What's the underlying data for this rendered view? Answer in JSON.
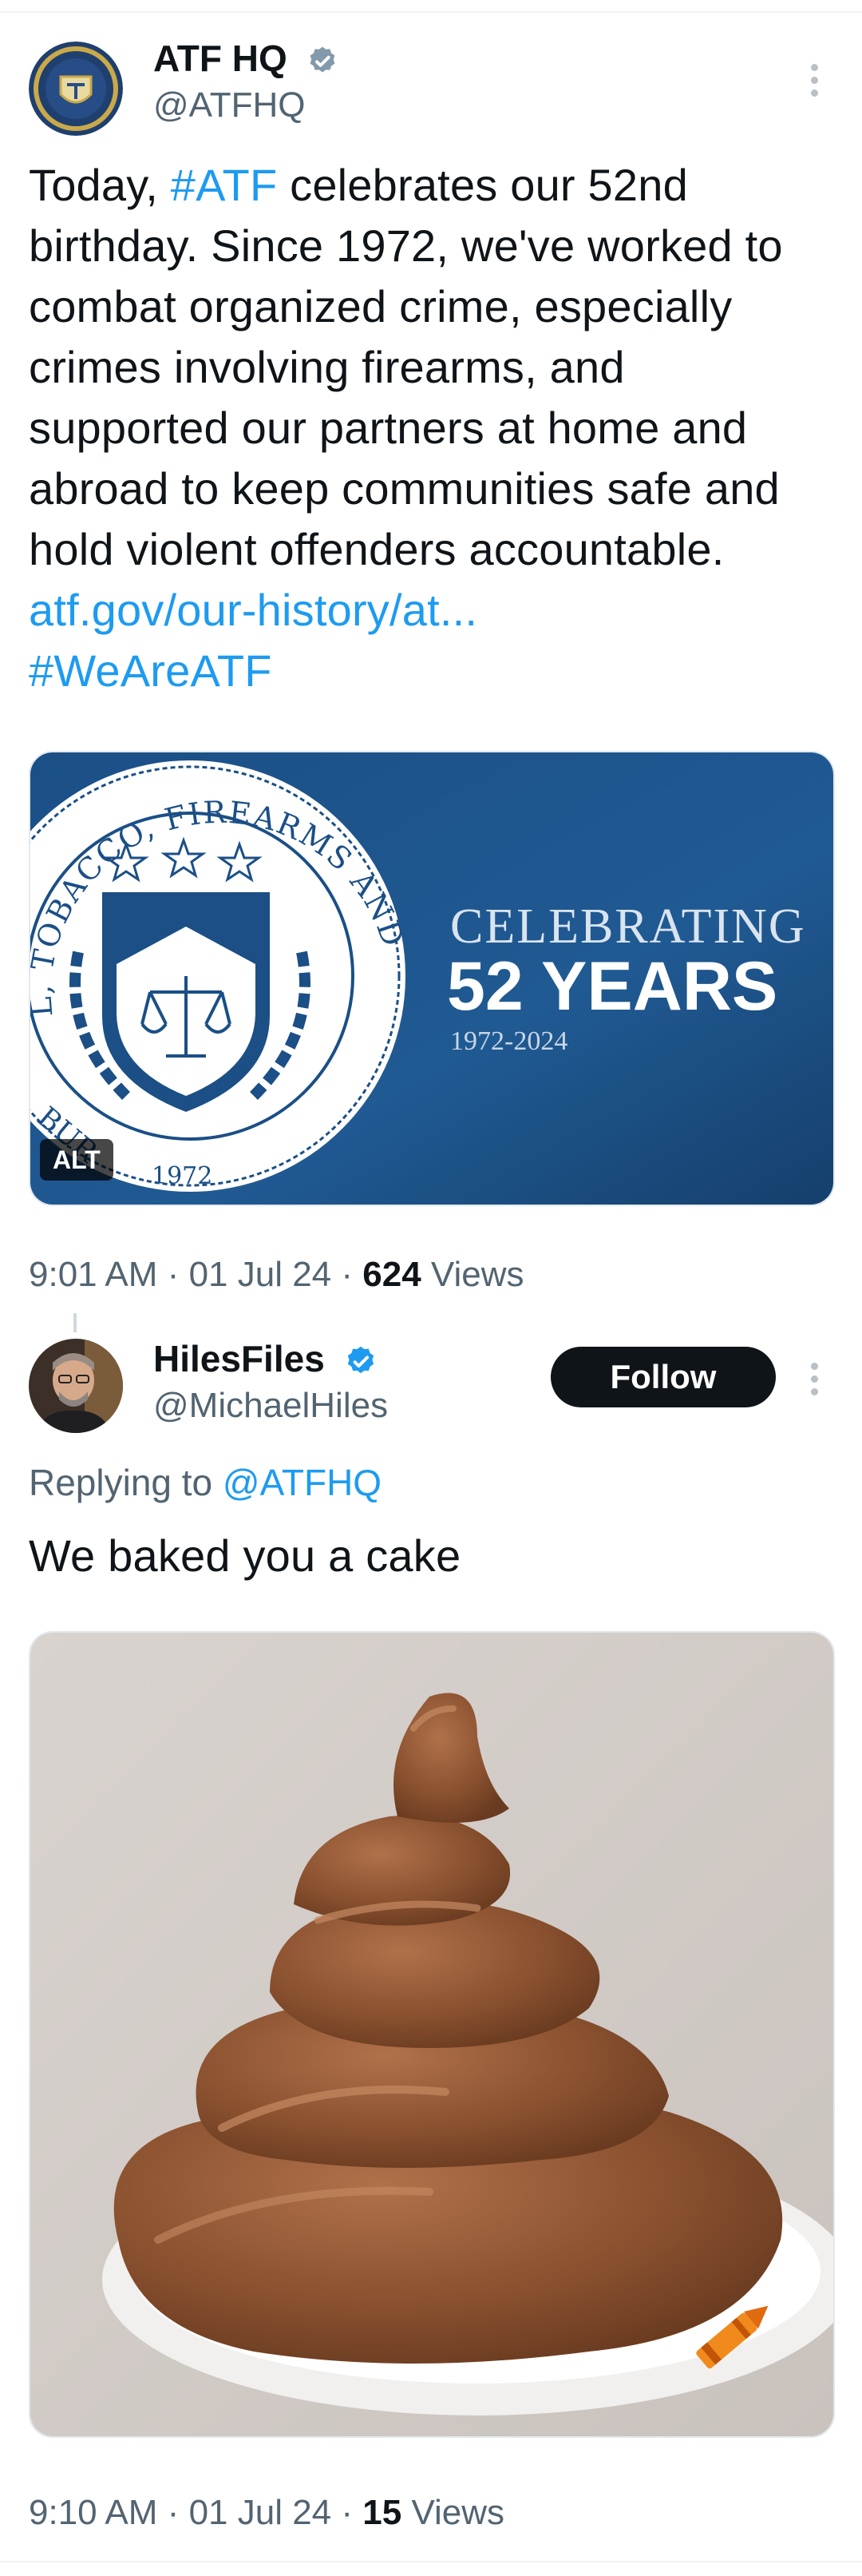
{
  "tweet1": {
    "name": "ATF HQ",
    "handle": "@ATFHQ",
    "text_parts": {
      "p1": "Today, ",
      "tag1": "#ATF",
      "p2": " celebrates our 52nd birthday. Since 1972, we've worked to combat organized crime, especially crimes involving firearms, and supported our partners at home and abroad to keep communities safe and hold violent offenders accountable. ",
      "url": "atf.gov/our-history/at...",
      "tag2": "#WeAreATF"
    },
    "image": {
      "seal_ring_top": "L, TOBACCO, FIREARMS AND EXPLOSIVES",
      "seal_ring_bottom": "BUR",
      "seal_year": "1972",
      "celebrating": "CELEBRATING",
      "years": "52 YEARS",
      "range": "1972-2024",
      "alt_badge": "ALT"
    },
    "meta": {
      "time": "9:01 AM",
      "sep": "·",
      "date": "01 Jul 24",
      "views_count": "624",
      "views_label": "Views"
    }
  },
  "tweet2": {
    "name": "HilesFiles",
    "handle": "@MichaelHiles",
    "follow_label": "Follow",
    "replying_prefix": "Replying to ",
    "replying_to": "@ATFHQ",
    "text": "We baked you a cake",
    "meta": {
      "time": "9:10 AM",
      "sep": "·",
      "date": "01 Jul 24",
      "views_count": "15",
      "views_label": "Views"
    }
  },
  "colors": {
    "link": "#1d9bf0",
    "secondary": "#536471",
    "atf_blue": "#1e4f82",
    "cake_brown": "#8b5230"
  },
  "icons": [
    "verified-badge-icon",
    "more-options-icon",
    "crayon-icon"
  ]
}
